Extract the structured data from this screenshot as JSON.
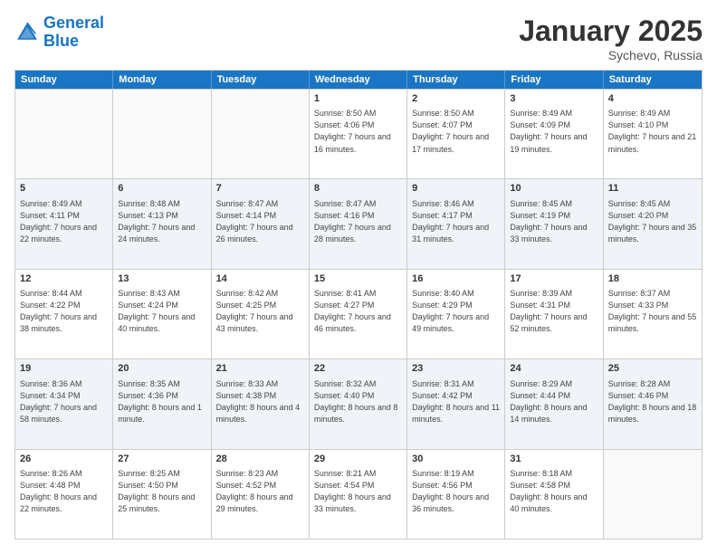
{
  "logo": {
    "line1": "General",
    "line2": "Blue"
  },
  "title": "January 2025",
  "location": "Sychevo, Russia",
  "days_of_week": [
    "Sunday",
    "Monday",
    "Tuesday",
    "Wednesday",
    "Thursday",
    "Friday",
    "Saturday"
  ],
  "rows": [
    [
      {
        "day": "",
        "sunrise": "",
        "sunset": "",
        "daylight": ""
      },
      {
        "day": "",
        "sunrise": "",
        "sunset": "",
        "daylight": ""
      },
      {
        "day": "",
        "sunrise": "",
        "sunset": "",
        "daylight": ""
      },
      {
        "day": "1",
        "sunrise": "Sunrise: 8:50 AM",
        "sunset": "Sunset: 4:06 PM",
        "daylight": "Daylight: 7 hours and 16 minutes."
      },
      {
        "day": "2",
        "sunrise": "Sunrise: 8:50 AM",
        "sunset": "Sunset: 4:07 PM",
        "daylight": "Daylight: 7 hours and 17 minutes."
      },
      {
        "day": "3",
        "sunrise": "Sunrise: 8:49 AM",
        "sunset": "Sunset: 4:09 PM",
        "daylight": "Daylight: 7 hours and 19 minutes."
      },
      {
        "day": "4",
        "sunrise": "Sunrise: 8:49 AM",
        "sunset": "Sunset: 4:10 PM",
        "daylight": "Daylight: 7 hours and 21 minutes."
      }
    ],
    [
      {
        "day": "5",
        "sunrise": "Sunrise: 8:49 AM",
        "sunset": "Sunset: 4:11 PM",
        "daylight": "Daylight: 7 hours and 22 minutes."
      },
      {
        "day": "6",
        "sunrise": "Sunrise: 8:48 AM",
        "sunset": "Sunset: 4:13 PM",
        "daylight": "Daylight: 7 hours and 24 minutes."
      },
      {
        "day": "7",
        "sunrise": "Sunrise: 8:47 AM",
        "sunset": "Sunset: 4:14 PM",
        "daylight": "Daylight: 7 hours and 26 minutes."
      },
      {
        "day": "8",
        "sunrise": "Sunrise: 8:47 AM",
        "sunset": "Sunset: 4:16 PM",
        "daylight": "Daylight: 7 hours and 28 minutes."
      },
      {
        "day": "9",
        "sunrise": "Sunrise: 8:46 AM",
        "sunset": "Sunset: 4:17 PM",
        "daylight": "Daylight: 7 hours and 31 minutes."
      },
      {
        "day": "10",
        "sunrise": "Sunrise: 8:45 AM",
        "sunset": "Sunset: 4:19 PM",
        "daylight": "Daylight: 7 hours and 33 minutes."
      },
      {
        "day": "11",
        "sunrise": "Sunrise: 8:45 AM",
        "sunset": "Sunset: 4:20 PM",
        "daylight": "Daylight: 7 hours and 35 minutes."
      }
    ],
    [
      {
        "day": "12",
        "sunrise": "Sunrise: 8:44 AM",
        "sunset": "Sunset: 4:22 PM",
        "daylight": "Daylight: 7 hours and 38 minutes."
      },
      {
        "day": "13",
        "sunrise": "Sunrise: 8:43 AM",
        "sunset": "Sunset: 4:24 PM",
        "daylight": "Daylight: 7 hours and 40 minutes."
      },
      {
        "day": "14",
        "sunrise": "Sunrise: 8:42 AM",
        "sunset": "Sunset: 4:25 PM",
        "daylight": "Daylight: 7 hours and 43 minutes."
      },
      {
        "day": "15",
        "sunrise": "Sunrise: 8:41 AM",
        "sunset": "Sunset: 4:27 PM",
        "daylight": "Daylight: 7 hours and 46 minutes."
      },
      {
        "day": "16",
        "sunrise": "Sunrise: 8:40 AM",
        "sunset": "Sunset: 4:29 PM",
        "daylight": "Daylight: 7 hours and 49 minutes."
      },
      {
        "day": "17",
        "sunrise": "Sunrise: 8:39 AM",
        "sunset": "Sunset: 4:31 PM",
        "daylight": "Daylight: 7 hours and 52 minutes."
      },
      {
        "day": "18",
        "sunrise": "Sunrise: 8:37 AM",
        "sunset": "Sunset: 4:33 PM",
        "daylight": "Daylight: 7 hours and 55 minutes."
      }
    ],
    [
      {
        "day": "19",
        "sunrise": "Sunrise: 8:36 AM",
        "sunset": "Sunset: 4:34 PM",
        "daylight": "Daylight: 7 hours and 58 minutes."
      },
      {
        "day": "20",
        "sunrise": "Sunrise: 8:35 AM",
        "sunset": "Sunset: 4:36 PM",
        "daylight": "Daylight: 8 hours and 1 minute."
      },
      {
        "day": "21",
        "sunrise": "Sunrise: 8:33 AM",
        "sunset": "Sunset: 4:38 PM",
        "daylight": "Daylight: 8 hours and 4 minutes."
      },
      {
        "day": "22",
        "sunrise": "Sunrise: 8:32 AM",
        "sunset": "Sunset: 4:40 PM",
        "daylight": "Daylight: 8 hours and 8 minutes."
      },
      {
        "day": "23",
        "sunrise": "Sunrise: 8:31 AM",
        "sunset": "Sunset: 4:42 PM",
        "daylight": "Daylight: 8 hours and 11 minutes."
      },
      {
        "day": "24",
        "sunrise": "Sunrise: 8:29 AM",
        "sunset": "Sunset: 4:44 PM",
        "daylight": "Daylight: 8 hours and 14 minutes."
      },
      {
        "day": "25",
        "sunrise": "Sunrise: 8:28 AM",
        "sunset": "Sunset: 4:46 PM",
        "daylight": "Daylight: 8 hours and 18 minutes."
      }
    ],
    [
      {
        "day": "26",
        "sunrise": "Sunrise: 8:26 AM",
        "sunset": "Sunset: 4:48 PM",
        "daylight": "Daylight: 8 hours and 22 minutes."
      },
      {
        "day": "27",
        "sunrise": "Sunrise: 8:25 AM",
        "sunset": "Sunset: 4:50 PM",
        "daylight": "Daylight: 8 hours and 25 minutes."
      },
      {
        "day": "28",
        "sunrise": "Sunrise: 8:23 AM",
        "sunset": "Sunset: 4:52 PM",
        "daylight": "Daylight: 8 hours and 29 minutes."
      },
      {
        "day": "29",
        "sunrise": "Sunrise: 8:21 AM",
        "sunset": "Sunset: 4:54 PM",
        "daylight": "Daylight: 8 hours and 33 minutes."
      },
      {
        "day": "30",
        "sunrise": "Sunrise: 8:19 AM",
        "sunset": "Sunset: 4:56 PM",
        "daylight": "Daylight: 8 hours and 36 minutes."
      },
      {
        "day": "31",
        "sunrise": "Sunrise: 8:18 AM",
        "sunset": "Sunset: 4:58 PM",
        "daylight": "Daylight: 8 hours and 40 minutes."
      },
      {
        "day": "",
        "sunrise": "",
        "sunset": "",
        "daylight": ""
      }
    ]
  ]
}
